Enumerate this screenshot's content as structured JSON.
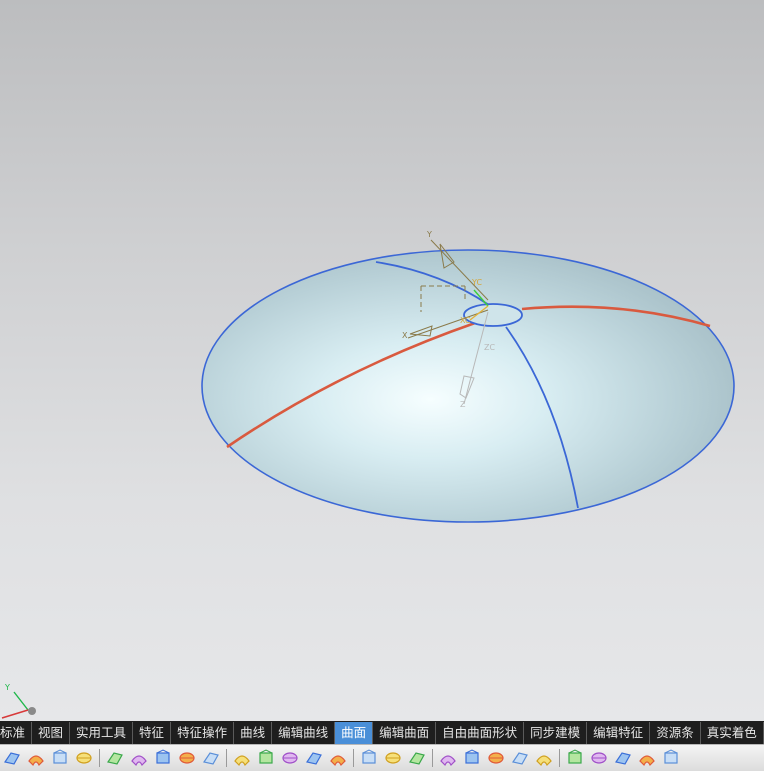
{
  "viewport": {
    "wcs_labels": {
      "y": "Y",
      "x": "X",
      "z": "Z"
    },
    "triad_labels": {
      "yc": "YC",
      "xc": "XC",
      "zc": "ZC"
    },
    "mini_triad_label": "Y"
  },
  "tabs": [
    {
      "label": "标准",
      "active": false
    },
    {
      "label": "视图",
      "active": false
    },
    {
      "label": "实用工具",
      "active": false
    },
    {
      "label": "特征",
      "active": false
    },
    {
      "label": "特征操作",
      "active": false
    },
    {
      "label": "曲线",
      "active": false
    },
    {
      "label": "编辑曲线",
      "active": false
    },
    {
      "label": "曲面",
      "active": true
    },
    {
      "label": "编辑曲面",
      "active": false
    },
    {
      "label": "自由曲面形状",
      "active": false
    },
    {
      "label": "同步建模",
      "active": false
    },
    {
      "label": "编辑特征",
      "active": false
    },
    {
      "label": "资源条",
      "active": false
    },
    {
      "label": "真实着色",
      "active": false
    }
  ],
  "toolbar_icons": [
    "point-surface-icon",
    "through-points-icon",
    "from-poles-icon",
    "ruled-surface-icon",
    "through-curves-icon",
    "through-curve-mesh-icon",
    "n-sided-surface-icon",
    "swept-icon",
    "section-surface-icon",
    "bridge-surface-icon",
    "offset-surface-icon",
    "extension-icon",
    "trim-sheet-icon",
    "sew-icon",
    "thicken-icon",
    "blend-icon",
    "face-blend-icon",
    "global-shaping-icon",
    "x-form-icon",
    "i-form-icon",
    "enlarge-icon",
    "law-extension-icon",
    "transition-icon",
    "patch-icon",
    "divide-face-icon",
    "flange-icon",
    "styled-sweep-icon"
  ],
  "colors": {
    "surface_edge": "#3b67d6",
    "surface_curve_red": "#d95a3f",
    "surface_fill": "#c3dde4",
    "active_tab": "#4a8fd8",
    "tab_bar": "#1e1e1e"
  }
}
